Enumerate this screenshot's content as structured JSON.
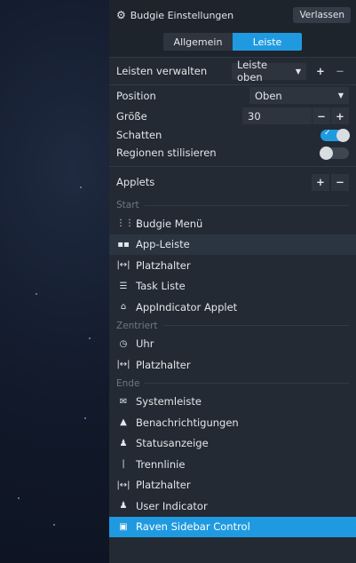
{
  "window": {
    "title": "Budgie Einstellungen",
    "close_label": "Verlassen"
  },
  "tabs": [
    {
      "label": "Allgemein"
    },
    {
      "label": "Leiste"
    }
  ],
  "manage": {
    "label": "Leisten verwalten",
    "panel_select": "Leiste oben",
    "add": "+",
    "remove": "−"
  },
  "settings": {
    "position": {
      "label": "Position",
      "value": "Oben"
    },
    "size": {
      "label": "Größe",
      "value": "30",
      "minus": "−",
      "plus": "+"
    },
    "shadow": {
      "label": "Schatten",
      "on": true
    },
    "stylize": {
      "label": "Regionen stilisieren",
      "on": false
    }
  },
  "applets": {
    "label": "Applets",
    "add": "+",
    "remove": "−",
    "sections": [
      {
        "name": "Start",
        "items": [
          {
            "icon": "grid-icon",
            "glyph": "⋮⋮⋮",
            "label": "Budgie Menü"
          },
          {
            "icon": "taskbar-icon",
            "glyph": "▪▪",
            "label": "App-Leiste"
          },
          {
            "icon": "spacer-icon",
            "glyph": "|↔|",
            "label": "Platzhalter"
          },
          {
            "icon": "list-icon",
            "glyph": "☰",
            "label": "Task Liste"
          },
          {
            "icon": "home-icon",
            "glyph": "⌂",
            "label": "AppIndicator Applet"
          }
        ]
      },
      {
        "name": "Zentriert",
        "items": [
          {
            "icon": "clock-icon",
            "glyph": "◷",
            "label": "Uhr"
          },
          {
            "icon": "spacer-icon",
            "glyph": "|↔|",
            "label": "Platzhalter"
          }
        ]
      },
      {
        "name": "Ende",
        "items": [
          {
            "icon": "tray-icon",
            "glyph": "✉",
            "label": "Systemleiste"
          },
          {
            "icon": "bell-icon",
            "glyph": "▲",
            "label": "Benachrichtigungen"
          },
          {
            "icon": "user-icon",
            "glyph": "♟",
            "label": "Statusanzeige"
          },
          {
            "icon": "separator-icon",
            "glyph": "|",
            "label": "Trennlinie"
          },
          {
            "icon": "spacer-icon",
            "glyph": "|↔|",
            "label": "Platzhalter"
          },
          {
            "icon": "user-icon",
            "glyph": "♟",
            "label": "User Indicator"
          },
          {
            "icon": "sidebar-icon",
            "glyph": "▣",
            "label": "Raven Sidebar Control"
          }
        ]
      }
    ]
  },
  "colors": {
    "accent": "#1f9ae0",
    "panel_bg": "#232a33"
  }
}
